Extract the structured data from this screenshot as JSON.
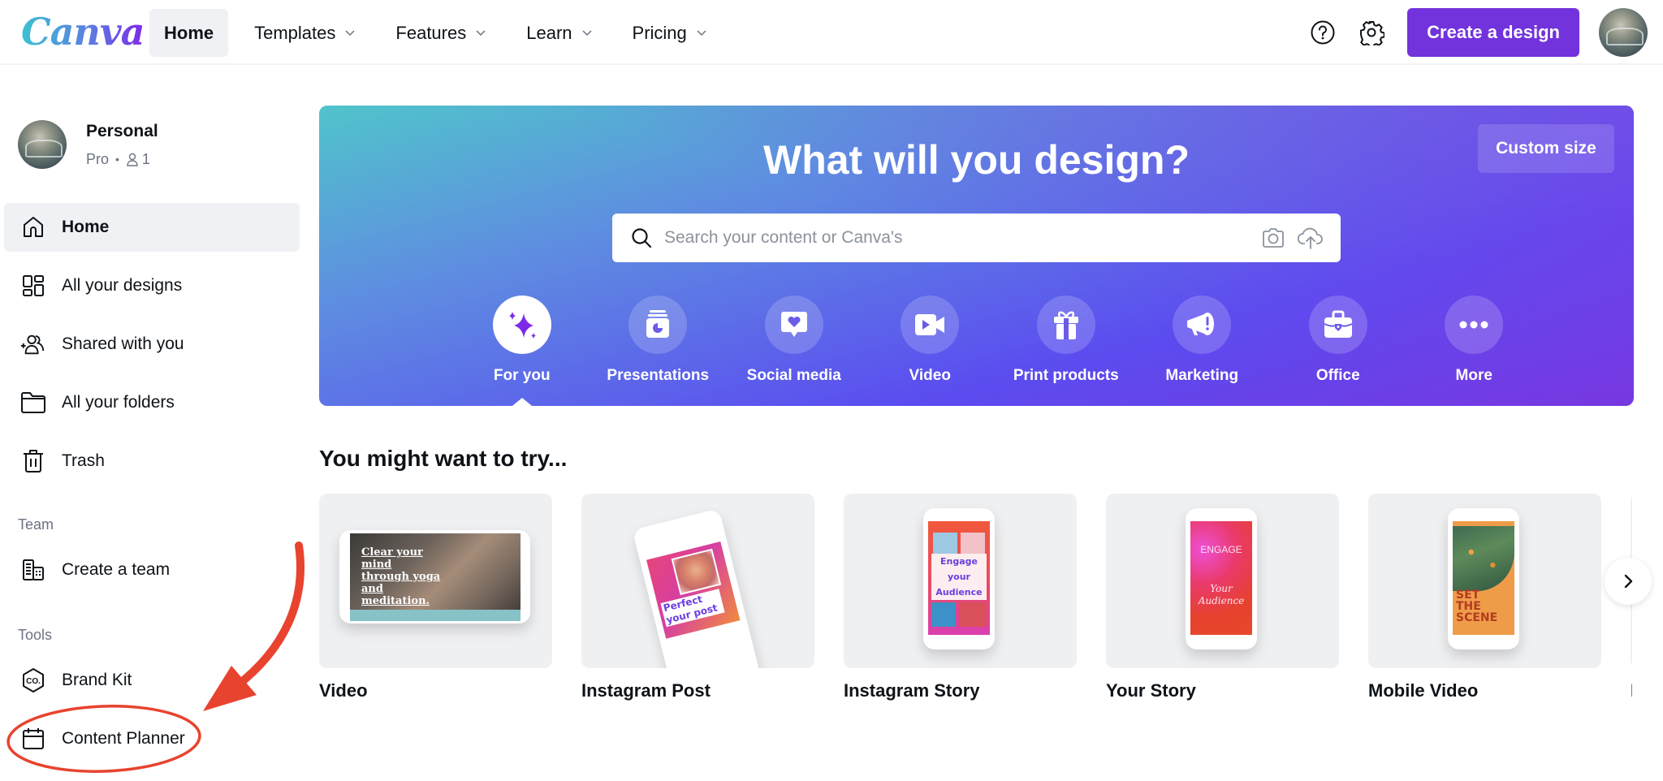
{
  "app": {
    "brand": "Canva"
  },
  "topnav": {
    "links": [
      {
        "label": "Home",
        "active": true,
        "has_menu": false
      },
      {
        "label": "Templates",
        "has_menu": true
      },
      {
        "label": "Features",
        "has_menu": true
      },
      {
        "label": "Learn",
        "has_menu": true
      },
      {
        "label": "Pricing",
        "has_menu": true
      }
    ],
    "help_icon": "question-circle-icon",
    "settings_icon": "gear-icon",
    "create_label": "Create a design",
    "brand_color": "#7232dc"
  },
  "sidebar": {
    "account": {
      "name": "Personal",
      "plan": "Pro",
      "members": "1"
    },
    "items": [
      {
        "label": "Home",
        "icon": "home-icon",
        "active": true
      },
      {
        "label": "All your designs",
        "icon": "grid-icon"
      },
      {
        "label": "Shared with you",
        "icon": "shared-users-icon"
      },
      {
        "label": "All your folders",
        "icon": "folder-icon"
      },
      {
        "label": "Trash",
        "icon": "trash-icon"
      }
    ],
    "team_label": "Team",
    "team_items": [
      {
        "label": "Create a team",
        "icon": "building-icon"
      }
    ],
    "tools_label": "Tools",
    "tools_items": [
      {
        "label": "Brand Kit",
        "icon": "brand-kit-icon"
      },
      {
        "label": "Content Planner",
        "icon": "calendar-icon",
        "highlighted": true
      }
    ]
  },
  "hero": {
    "title": "What will you design?",
    "custom_size_label": "Custom size",
    "search_placeholder": "Search your content or Canva's",
    "search_value": "",
    "categories": [
      {
        "label": "For you",
        "icon": "sparkle-icon",
        "active": true
      },
      {
        "label": "Presentations",
        "icon": "presentation-icon"
      },
      {
        "label": "Social media",
        "icon": "heart-bubble-icon"
      },
      {
        "label": "Video",
        "icon": "video-camera-icon"
      },
      {
        "label": "Print products",
        "icon": "gift-icon"
      },
      {
        "label": "Marketing",
        "icon": "megaphone-icon"
      },
      {
        "label": "Office",
        "icon": "briefcase-icon"
      },
      {
        "label": "More",
        "icon": "more-dots-icon"
      }
    ]
  },
  "suggestions": {
    "title": "You might want to try...",
    "cards": [
      {
        "label": "Video",
        "preview_text": "Clear your mind through yoga and meditation."
      },
      {
        "label": "Instagram Post",
        "preview_text": "Perfect your post"
      },
      {
        "label": "Instagram Story",
        "preview_text": "Engage your Audience"
      },
      {
        "label": "Your Story",
        "preview_text_top": "ENGAGE",
        "preview_text_bottom": "Your Audience"
      },
      {
        "label": "Mobile Video",
        "preview_text": "SET THE SCENE"
      },
      {
        "label": "P"
      }
    ]
  },
  "annotation": {
    "color": "#e8432e",
    "target": "Content Planner"
  }
}
